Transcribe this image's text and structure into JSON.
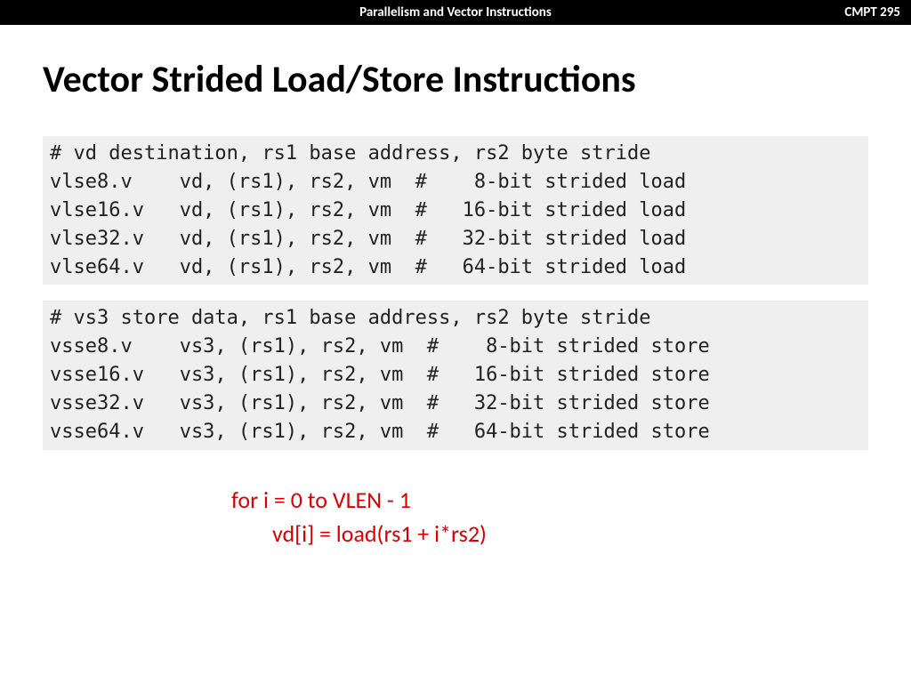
{
  "header": {
    "center": "Parallelism and Vector Instructions",
    "right": "CMPT 295"
  },
  "title": "Vector Strided Load/Store Instructions",
  "code_load": "# vd destination, rs1 base address, rs2 byte stride\nvlse8.v    vd, (rs1), rs2, vm  #    8-bit strided load\nvlse16.v   vd, (rs1), rs2, vm  #   16-bit strided load\nvlse32.v   vd, (rs1), rs2, vm  #   32-bit strided load\nvlse64.v   vd, (rs1), rs2, vm  #   64-bit strided load",
  "code_store": "# vs3 store data, rs1 base address, rs2 byte stride\nvsse8.v    vs3, (rs1), rs2, vm  #    8-bit strided store\nvsse16.v   vs3, (rs1), rs2, vm  #   16-bit strided store\nvsse32.v   vs3, (rs1), rs2, vm  #   32-bit strided store\nvsse64.v   vs3, (rs1), rs2, vm  #   64-bit strided store",
  "pseudo_line1": "for i = 0 to VLEN - 1",
  "pseudo_line2": "vd[i] = load(rs1 + i*rs2)"
}
